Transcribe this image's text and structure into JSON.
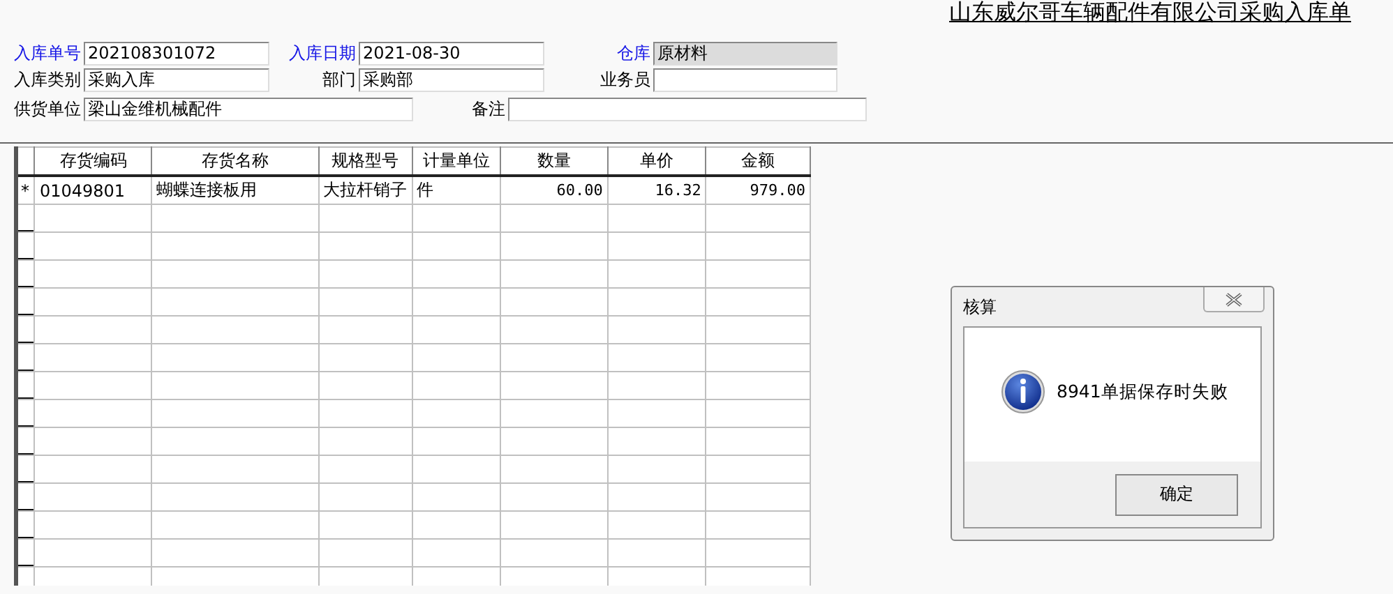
{
  "document_title": "山东威尔哥车辆配件有限公司采购入库单",
  "form": {
    "rows": [
      {
        "kind": "triple",
        "fields": [
          {
            "label": "入库单号",
            "value": "202108301072",
            "highlighted": true,
            "readonly": false
          },
          {
            "label": "入库日期",
            "value": "2021-08-30",
            "highlighted": true,
            "readonly": false
          },
          {
            "label": "仓库",
            "value": "原材料",
            "highlighted": true,
            "readonly": true
          }
        ]
      },
      {
        "kind": "triple",
        "fields": [
          {
            "label": "入库类别",
            "value": "采购入库",
            "highlighted": false,
            "readonly": false
          },
          {
            "label": "部门",
            "value": "采购部",
            "highlighted": false,
            "readonly": false
          },
          {
            "label": "业务员",
            "highlighted": false,
            "readonly": false
          }
        ]
      },
      {
        "kind": "double",
        "fields": [
          {
            "label": "供货单位",
            "value": "梁山金维机械配件",
            "highlighted": false,
            "readonly": false
          },
          {
            "label": "备注",
            "highlighted": false,
            "readonly": false
          }
        ]
      }
    ]
  },
  "table": {
    "columns": [
      {
        "label": "存货编码",
        "kind": "text"
      },
      {
        "label": "存货名称",
        "kind": "text"
      },
      {
        "label": "规格型号",
        "kind": "text"
      },
      {
        "label": "计量单位",
        "kind": "text"
      },
      {
        "label": "数量",
        "kind": "number"
      },
      {
        "label": "单价",
        "kind": "number"
      },
      {
        "label": "金额",
        "kind": "number"
      }
    ],
    "rows": [
      {
        "marker": "*",
        "cells": [
          "01049801",
          "蝴蝶连接板用",
          "大拉杆销子",
          "件",
          "60.00",
          "16.32",
          "979.00"
        ]
      }
    ]
  },
  "dialog": {
    "title": "核算",
    "message": "8941单据保存时失败",
    "buttons": [
      "确定"
    ]
  }
}
